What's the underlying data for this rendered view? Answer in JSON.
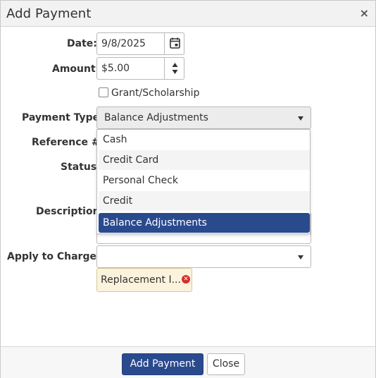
{
  "dialog": {
    "title": "Add Payment",
    "close_label": "×"
  },
  "form": {
    "date_label": "Date:",
    "date_value": "9/8/2025",
    "amount_label": "Amount:",
    "amount_value": "$5.00",
    "grant_label": "Grant/Scholarship",
    "grant_checked": false,
    "payment_type_label": "Payment Type:",
    "payment_type_value": "Balance Adjustments",
    "reference_label": "Reference #:",
    "status_label": "Status:",
    "description_label": "Description:",
    "apply_label": "Apply to Charges:",
    "apply_value": ""
  },
  "payment_type_options": [
    {
      "label": "Cash",
      "selected": false
    },
    {
      "label": "Credit Card",
      "selected": false
    },
    {
      "label": "Personal Check",
      "selected": false
    },
    {
      "label": "Credit",
      "selected": false
    },
    {
      "label": "Balance Adjustments",
      "selected": true
    }
  ],
  "charge_tags": [
    {
      "label": "Replacement I..."
    }
  ],
  "footer": {
    "add_button": "Add Payment",
    "close_button": "Close"
  },
  "colors": {
    "primary": "#2a4a8e",
    "tag_bg": "#fcf3dc",
    "remove_icon": "#d82c2c"
  }
}
